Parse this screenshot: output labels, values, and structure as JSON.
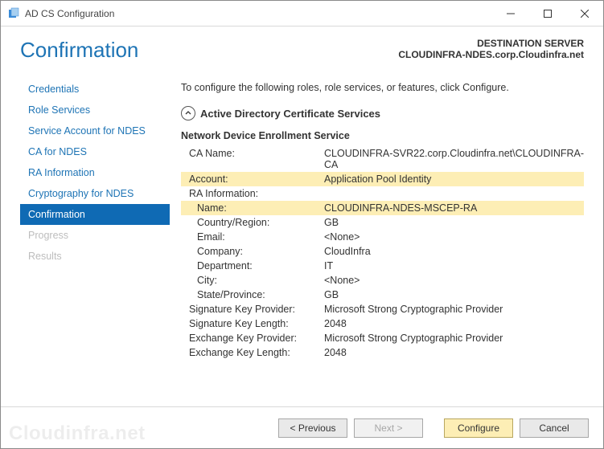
{
  "window": {
    "title": "AD CS Configuration"
  },
  "header": {
    "pageTitle": "Confirmation",
    "destLabel": "DESTINATION SERVER",
    "destServer": "CLOUDINFRA-NDES.corp.Cloudinfra.net"
  },
  "sidebar": {
    "items": [
      {
        "label": "Credentials",
        "state": "normal"
      },
      {
        "label": "Role Services",
        "state": "normal"
      },
      {
        "label": "Service Account for NDES",
        "state": "normal"
      },
      {
        "label": "CA for NDES",
        "state": "normal"
      },
      {
        "label": "RA Information",
        "state": "normal"
      },
      {
        "label": "Cryptography for NDES",
        "state": "normal"
      },
      {
        "label": "Confirmation",
        "state": "selected"
      },
      {
        "label": "Progress",
        "state": "disabled"
      },
      {
        "label": "Results",
        "state": "disabled"
      }
    ]
  },
  "main": {
    "instruction": "To configure the following roles, role services, or features, click Configure.",
    "sectionTitle": "Active Directory Certificate Services",
    "subheader": "Network Device Enrollment Service",
    "rows": [
      {
        "k": "CA Name:",
        "v": "CLOUDINFRA-SVR22.corp.Cloudinfra.net\\CLOUDINFRA-CA",
        "indent": 1,
        "hl": false
      },
      {
        "k": "Account:",
        "v": "Application Pool Identity",
        "indent": 1,
        "hl": true
      },
      {
        "k": "RA Information:",
        "v": "",
        "indent": 1,
        "hl": false
      },
      {
        "k": "Name:",
        "v": "CLOUDINFRA-NDES-MSCEP-RA",
        "indent": 2,
        "hl": true
      },
      {
        "k": "Country/Region:",
        "v": "GB",
        "indent": 2,
        "hl": false
      },
      {
        "k": "Email:",
        "v": "<None>",
        "indent": 2,
        "hl": false
      },
      {
        "k": "Company:",
        "v": "CloudInfra",
        "indent": 2,
        "hl": false
      },
      {
        "k": "Department:",
        "v": "IT",
        "indent": 2,
        "hl": false
      },
      {
        "k": "City:",
        "v": "<None>",
        "indent": 2,
        "hl": false
      },
      {
        "k": "State/Province:",
        "v": "GB",
        "indent": 2,
        "hl": false
      },
      {
        "k": "Signature Key Provider:",
        "v": "Microsoft Strong Cryptographic Provider",
        "indent": 1,
        "hl": false
      },
      {
        "k": "Signature Key Length:",
        "v": "2048",
        "indent": 1,
        "hl": false
      },
      {
        "k": "Exchange Key Provider:",
        "v": "Microsoft Strong Cryptographic Provider",
        "indent": 1,
        "hl": false
      },
      {
        "k": "Exchange Key Length:",
        "v": "2048",
        "indent": 1,
        "hl": false
      }
    ]
  },
  "footer": {
    "previous": "< Previous",
    "next": "Next >",
    "configure": "Configure",
    "cancel": "Cancel",
    "watermark": "Cloudinfra.net"
  }
}
